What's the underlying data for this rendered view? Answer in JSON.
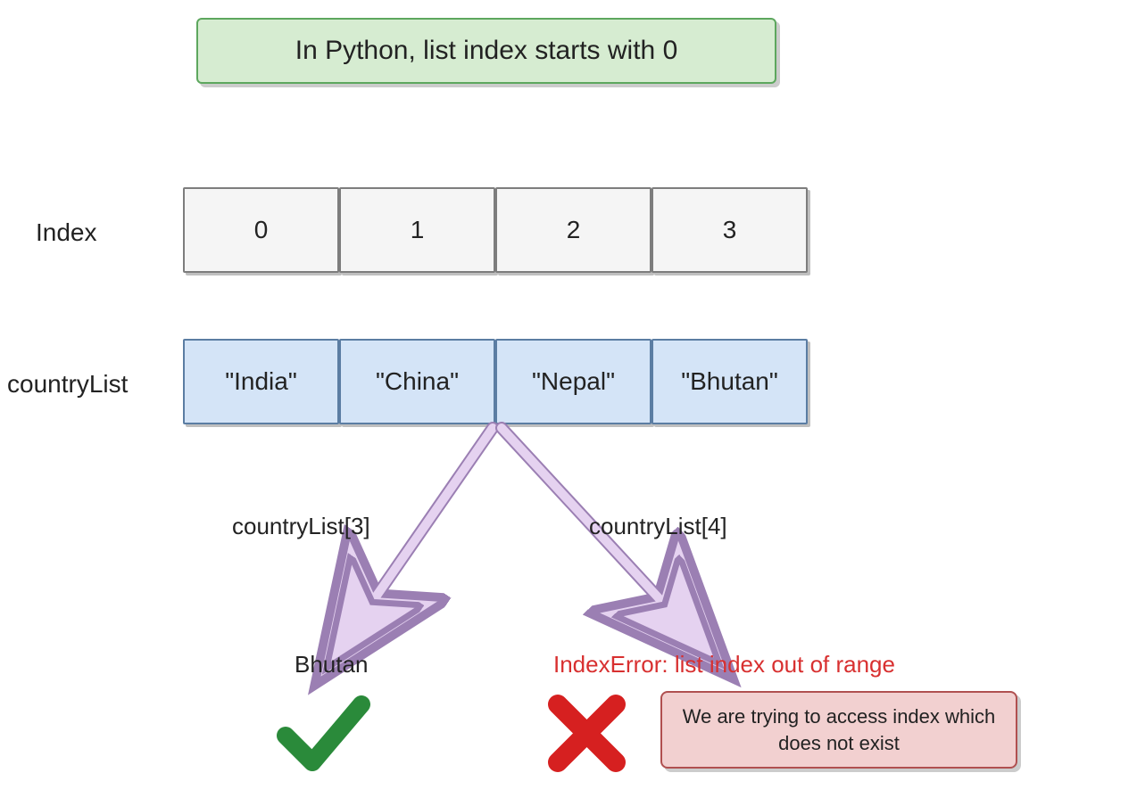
{
  "banner": "In Python, list index starts with 0",
  "indexLabel": "Index",
  "listLabel": "countryList",
  "indices": [
    "0",
    "1",
    "2",
    "3"
  ],
  "items": [
    "\"India\"",
    "\"China\"",
    "\"Nepal\"",
    "\"Bhutan\""
  ],
  "leftAccess": "countryList[3]",
  "rightAccess": "countryList[4]",
  "leftResult": "Bhutan",
  "errorTitle": "IndexError: list index out of range",
  "errorExplain": "We are trying to access index which does not exist",
  "colors": {
    "arrowFill": "#e5d2f0",
    "arrowStroke": "#9b7fb3",
    "checkGreen": "#2a8a3a",
    "crossRed": "#d62020"
  }
}
